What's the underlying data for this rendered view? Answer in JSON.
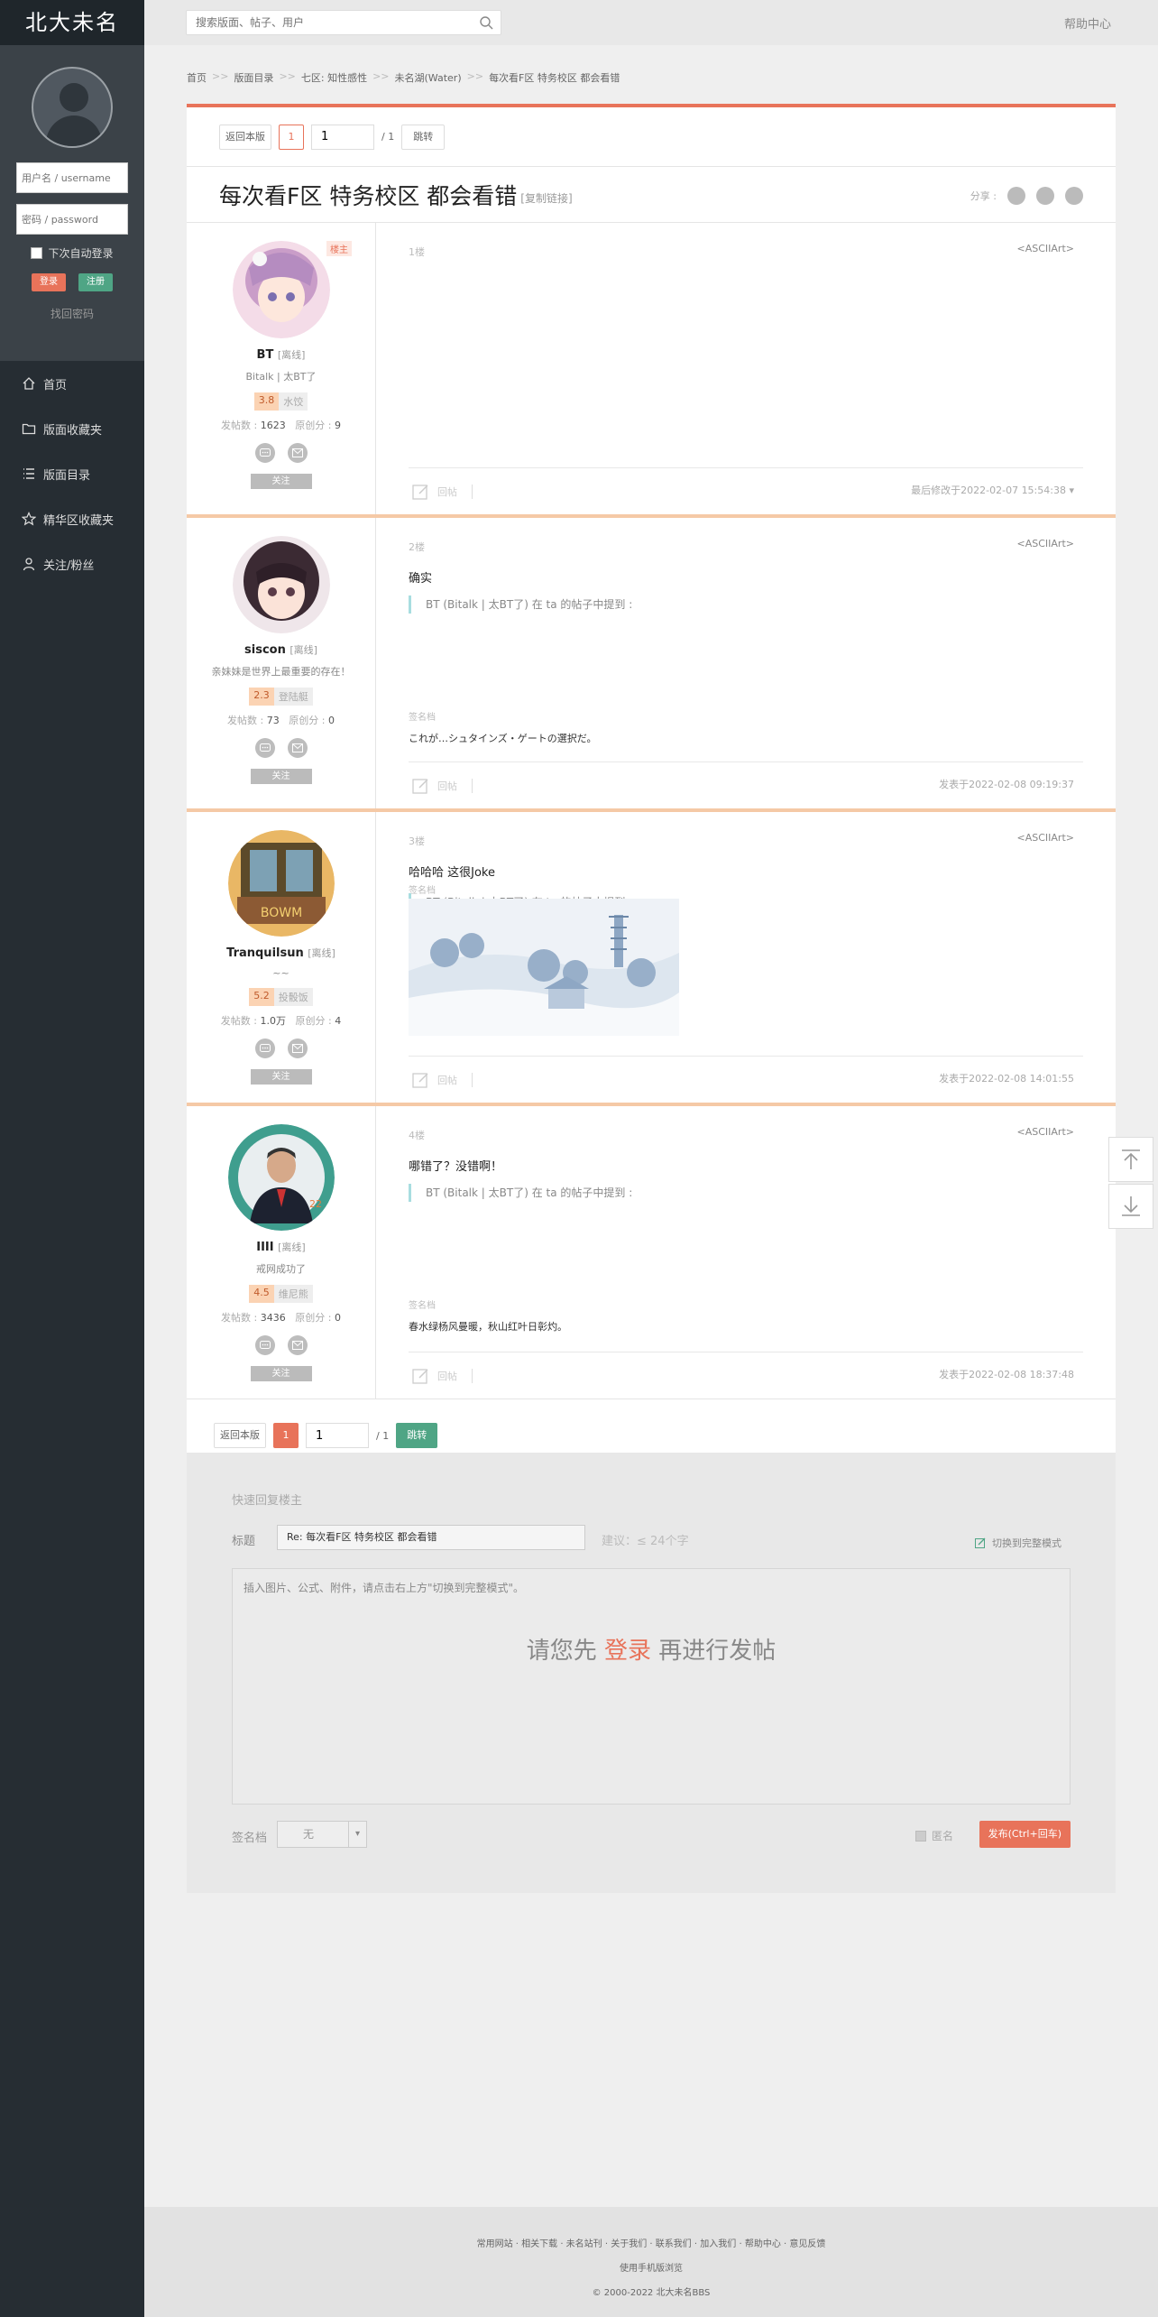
{
  "sidebar": {
    "logo": "北大未名",
    "username_placeholder": "用户名 / username",
    "password_placeholder": "密码 / password",
    "auto_login": "下次自动登录",
    "login": "登录",
    "register": "注册",
    "find_password": "找回密码",
    "nav": [
      {
        "label": "首页",
        "icon": "home-icon"
      },
      {
        "label": "版面收藏夹",
        "icon": "folder-icon"
      },
      {
        "label": "版面目录",
        "icon": "list-icon"
      },
      {
        "label": "精华区收藏夹",
        "icon": "star-icon"
      },
      {
        "label": "关注/粉丝",
        "icon": "user-icon"
      }
    ]
  },
  "topbar": {
    "search_placeholder": "搜索版面、帖子、用户",
    "help": "帮助中心"
  },
  "breadcrumb": [
    "首页",
    "版面目录",
    "七区: 知性感性",
    "未名湖(Water)",
    "每次看F区 特务校区 都会看错"
  ],
  "pager": {
    "back": "返回本版",
    "page": "1",
    "input": "1",
    "total": "/ 1",
    "jump": "跳转"
  },
  "thread": {
    "title": "每次看F区 特务校区 都会看错",
    "copy_link": "[复制链接]",
    "share": "分享 :"
  },
  "posts": [
    {
      "user": "BT",
      "status": "[离线]",
      "owner": "楼主",
      "sig": "Bitalk | 太BT了",
      "level": "3.8",
      "level_title": "水饺",
      "posts_label": "发帖数 :",
      "posts": "1623",
      "orig_label": "原创分 :",
      "orig": "9",
      "follow": "关注",
      "floor": "1楼",
      "ascii": "<ASCIIArt>",
      "text": "",
      "quote": "",
      "sig_label": "",
      "sig_text": "",
      "reply": "回帖",
      "time": "最后修改于2022-02-07 15:54:38 ▾"
    },
    {
      "user": "siscon",
      "status": "[离线]",
      "owner": "",
      "sig": "亲妹妹是世界上最重要的存在！",
      "level": "2.3",
      "level_title": "登陆艇",
      "posts_label": "发帖数 :",
      "posts": "73",
      "orig_label": "原创分 :",
      "orig": "0",
      "follow": "关注",
      "floor": "2楼",
      "ascii": "<ASCIIArt>",
      "text": "确实",
      "quote": "BT (Bitalk | 太BT了) 在 ta 的帖子中提到 :",
      "sig_label": "签名档",
      "sig_text": "これが…シュタインズ・ゲートの選択だ。",
      "reply": "回帖",
      "time": "发表于2022-02-08 09:19:37"
    },
    {
      "user": "Tranquilsun",
      "status": "[离线]",
      "owner": "",
      "sig": "~~",
      "level": "5.2",
      "level_title": "投骰饭",
      "posts_label": "发帖数 :",
      "posts": "1.0万",
      "orig_label": "原创分 :",
      "orig": "4",
      "follow": "关注",
      "floor": "3楼",
      "ascii": "<ASCIIArt>",
      "text": "哈哈哈  这很Joke",
      "quote": "BT (Bitalk | 太BT了) 在 ta 的帖子中提到 :",
      "sig_label": "签名档",
      "sig_text": "",
      "reply": "回帖",
      "time": "发表于2022-02-08 14:01:55"
    },
    {
      "user": "IIII",
      "status": "[离线]",
      "owner": "",
      "sig": "戒网成功了",
      "level": "4.5",
      "level_title": "维尼熊",
      "posts_label": "发帖数 :",
      "posts": "3436",
      "orig_label": "原创分 :",
      "orig": "0",
      "follow": "关注",
      "floor": "4楼",
      "ascii": "<ASCIIArt>",
      "text": "哪错了？没错啊！",
      "quote": "BT (Bitalk | 太BT了) 在 ta 的帖子中提到 :",
      "sig_label": "签名档",
      "sig_text": "春水绿杨风曼暖，秋山红叶日彰灼。",
      "reply": "回帖",
      "time": "发表于2022-02-08 18:37:48"
    }
  ],
  "quick_reply": {
    "header": "快速回复楼主",
    "title_label": "标题",
    "title_value": "Re: 每次看F区 特务校区 都会看错",
    "suggest": "建议：≤ 24个字",
    "full_mode": "切换到完整模式",
    "placeholder": "插入图片、公式、附件，请点击右上方\"切换到完整模式\"。",
    "login_pre": "请您先",
    "login_link": "登录",
    "login_post": "再进行发帖",
    "sig_label": "签名档",
    "sig_value": "无",
    "anonymous": "匿名",
    "publish": "发布(Ctrl+回车)"
  },
  "footer": {
    "links": "常用网站 · 相关下载 · 未名站刊 · 关于我们 · 联系我们 · 加入我们 · 帮助中心 · 意见反馈",
    "mobile": "使用手机版浏览",
    "copyright": "© 2000-2022 北大未名BBS"
  },
  "colors": {
    "accent": "#e8735a",
    "green": "#4fa585",
    "sidebar": "#262d33"
  }
}
